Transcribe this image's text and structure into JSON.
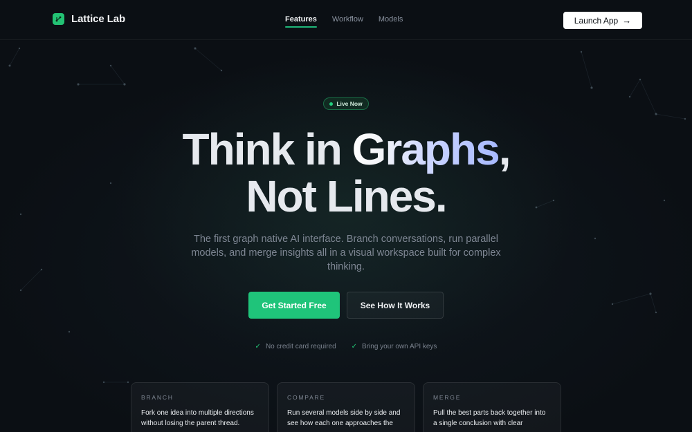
{
  "nav": {
    "brand": "Lattice Lab",
    "links": [
      "Features",
      "Workflow",
      "Models"
    ],
    "active": "Features",
    "launch_label": "Launch App",
    "launch_arrow": "→"
  },
  "hero": {
    "badge": "Live Now",
    "headline_1a": "Think in ",
    "headline_1b": "Graphs",
    "headline_1c": ",",
    "headline_2": "Not Lines.",
    "subtitle": "The first graph native AI interface. Branch conversations, run parallel models, and merge insights all in a visual workspace built for complex thinking.",
    "primary_cta": "Get Started Free",
    "secondary_cta": "See How It Works",
    "perks": [
      "No credit card required",
      "Bring your own API keys"
    ]
  },
  "cards": [
    {
      "label": "BRANCH",
      "text": "Fork one idea into multiple directions without losing the parent thread."
    },
    {
      "label": "COMPARE",
      "text": "Run several models side by side and see how each one approaches the"
    },
    {
      "label": "MERGE",
      "text": "Pull the best parts back together into a single conclusion with clear"
    }
  ],
  "colors": {
    "background": "#0b0f14",
    "accent": "#1fc47a",
    "headline_gradient_end": "#a7b9ff"
  }
}
